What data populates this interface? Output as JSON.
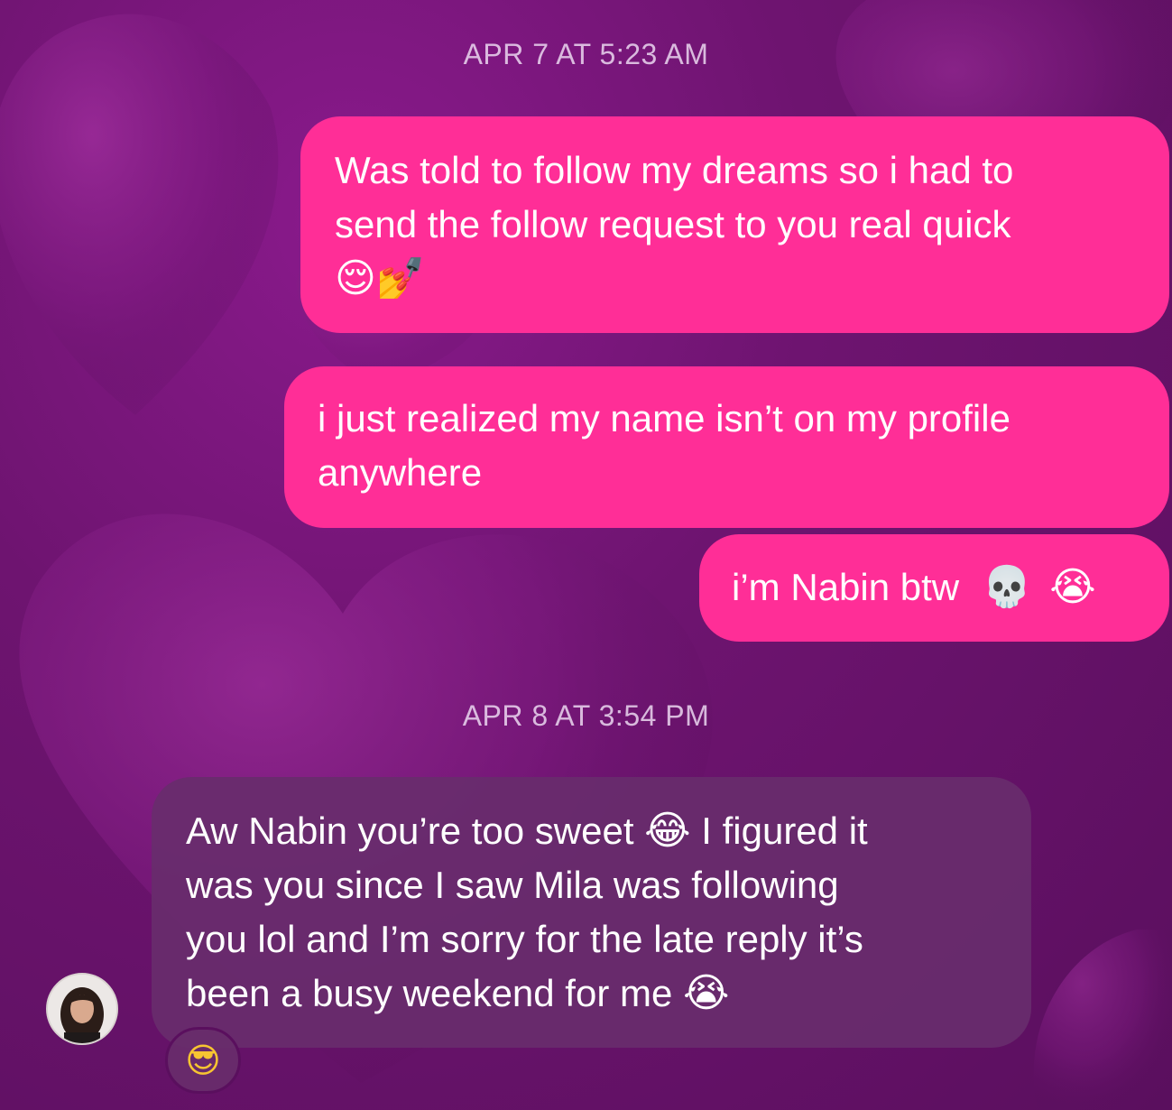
{
  "theme": {
    "outgoing_bubble_color": "#ff2e97",
    "incoming_bubble_color": "#682c6c",
    "background_color": "#6e1470",
    "background_pattern": "purple-hearts"
  },
  "conversation": {
    "groups": [
      {
        "timestamp": "APR 7 AT 5:23 AM",
        "messages": [
          {
            "direction": "outgoing",
            "lines": [
              "Was told to follow my dreams so i had to",
              "send the follow request to you real quick"
            ],
            "emojis": [
              "😌",
              "💅"
            ]
          },
          {
            "direction": "outgoing",
            "lines": [
              "i just realized my name isn’t on my profile",
              "anywhere"
            ]
          },
          {
            "direction": "outgoing",
            "text": "i’m Nabin btw",
            "emojis": [
              "💀",
              "😭"
            ]
          }
        ]
      },
      {
        "timestamp": "APR 8 AT 3:54 PM",
        "messages": [
          {
            "direction": "incoming",
            "line1_a": "Aw Nabin you’re too sweet",
            "line1_emoji": "😂",
            "line1_b": "I figured it",
            "line2": "was you since I saw Mila was following",
            "line3": "you lol and I’m sorry for the late reply it’s",
            "line4": "been a busy weekend for me",
            "line4_emoji": "😭",
            "avatar_icon": "user-avatar-photo",
            "reaction": "😎"
          }
        ]
      }
    ]
  }
}
